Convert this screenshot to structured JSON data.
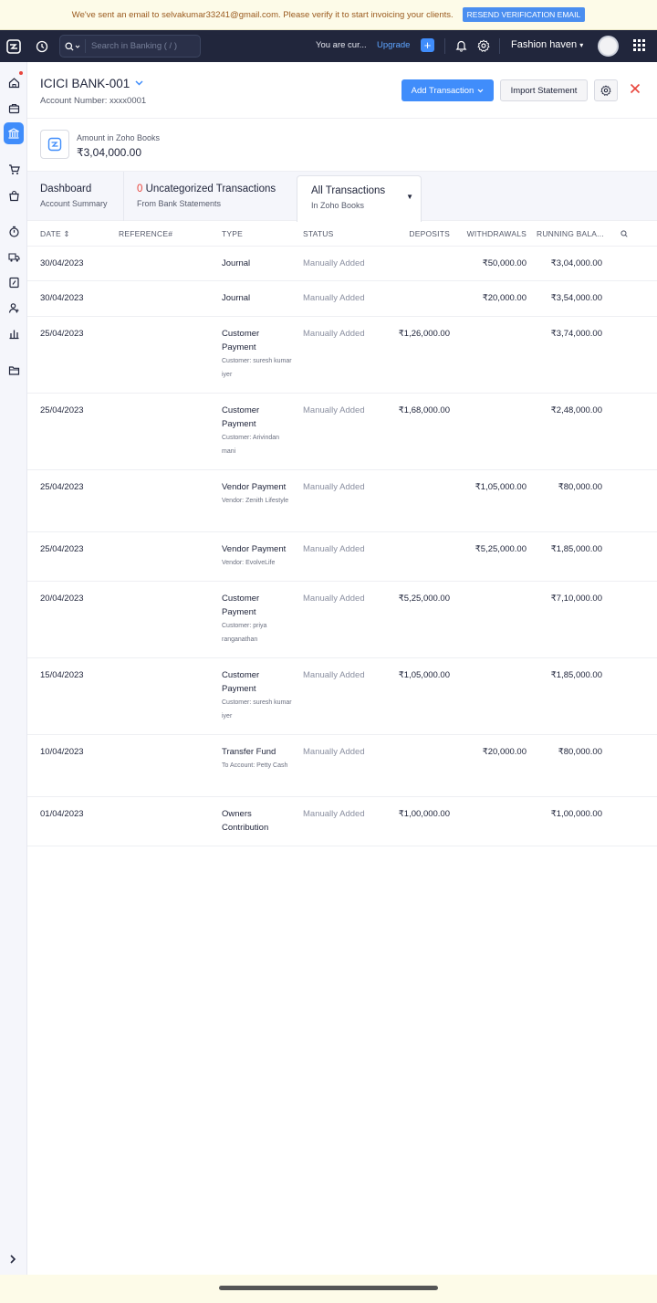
{
  "banner": {
    "message": "We've sent an email to selvakumar33241@gmail.com. Please verify it to start invoicing your clients.",
    "action": "RESEND VERIFICATION EMAIL"
  },
  "topbar": {
    "search_placeholder": "Search in Banking ( / )",
    "trial_text": "You are cur...",
    "upgrade_label": "Upgrade",
    "org_name": "Fashion haven"
  },
  "account": {
    "name": "ICICI BANK-001",
    "number_label": "Account Number: xxxx0001",
    "add_transaction_label": "Add Transaction",
    "import_statement_label": "Import Statement"
  },
  "balance": {
    "label": "Amount in Zoho Books",
    "value": "₹3,04,000.00"
  },
  "tabs": {
    "dashboard": {
      "title": "Dashboard",
      "subtitle": "Account Summary"
    },
    "uncategorized": {
      "count": "0",
      "title": "Uncategorized Transactions",
      "subtitle": "From Bank Statements"
    },
    "all": {
      "title": "All Transactions",
      "subtitle": "In Zoho Books"
    }
  },
  "columns": {
    "date": "DATE",
    "reference": "REFERENCE#",
    "type": "TYPE",
    "status": "STATUS",
    "deposits": "DEPOSITS",
    "withdrawals": "WITHDRAWALS",
    "running_balance": "RUNNING BALA..."
  },
  "rows": [
    {
      "date": "30/04/2023",
      "type": "Journal",
      "sub": "",
      "status": "Manually Added",
      "deposit": "",
      "withdrawal": "₹50,000.00",
      "balance": "₹3,04,000.00"
    },
    {
      "date": "30/04/2023",
      "type": "Journal",
      "sub": "",
      "status": "Manually Added",
      "deposit": "",
      "withdrawal": "₹20,000.00",
      "balance": "₹3,54,000.00"
    },
    {
      "date": "25/04/2023",
      "type": "Customer Payment",
      "sub": "Customer: suresh kumar iyer",
      "status": "Manually Added",
      "deposit": "₹1,26,000.00",
      "withdrawal": "",
      "balance": "₹3,74,000.00"
    },
    {
      "date": "25/04/2023",
      "type": "Customer Payment",
      "sub": "Customer: Arivindan mani",
      "status": "Manually Added",
      "deposit": "₹1,68,000.00",
      "withdrawal": "",
      "balance": "₹2,48,000.00"
    },
    {
      "date": "25/04/2023",
      "type": "Vendor Payment",
      "sub": "Vendor: Zenith Lifestyle",
      "status": "Manually Added",
      "deposit": "",
      "withdrawal": "₹1,05,000.00",
      "balance": "₹80,000.00"
    },
    {
      "date": "25/04/2023",
      "type": "Vendor Payment",
      "sub": "Vendor: EvolveLife",
      "status": "Manually Added",
      "deposit": "",
      "withdrawal": "₹5,25,000.00",
      "balance": "₹1,85,000.00"
    },
    {
      "date": "20/04/2023",
      "type": "Customer Payment",
      "sub": "Customer: priya ranganathan",
      "status": "Manually Added",
      "deposit": "₹5,25,000.00",
      "withdrawal": "",
      "balance": "₹7,10,000.00"
    },
    {
      "date": "15/04/2023",
      "type": "Customer Payment",
      "sub": "Customer: suresh kumar iyer",
      "status": "Manually Added",
      "deposit": "₹1,05,000.00",
      "withdrawal": "",
      "balance": "₹1,85,000.00"
    },
    {
      "date": "10/04/2023",
      "type": "Transfer Fund",
      "sub": "To Account: Petty Cash",
      "status": "Manually Added",
      "deposit": "",
      "withdrawal": "₹20,000.00",
      "balance": "₹80,000.00"
    },
    {
      "date": "01/04/2023",
      "type": "Owners Contribution",
      "sub": "",
      "status": "Manually Added",
      "deposit": "₹1,00,000.00",
      "withdrawal": "",
      "balance": "₹1,00,000.00"
    }
  ],
  "colors": {
    "primary": "#408dfb",
    "topbar": "#21263c",
    "banner_bg": "#fdfbe8",
    "danger": "#e8453c"
  }
}
